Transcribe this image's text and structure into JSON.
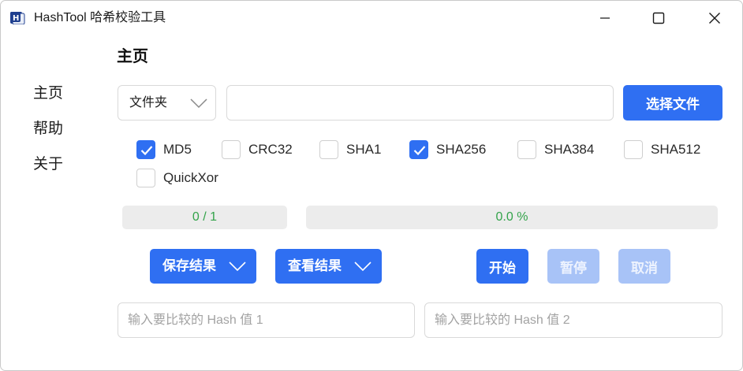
{
  "window": {
    "title": "HashTool 哈希校验工具",
    "icon": "hashtool-app-icon",
    "controls": [
      "minimize-icon",
      "maximize-icon",
      "close-icon"
    ]
  },
  "sidebar": {
    "items": [
      {
        "label": "主页"
      },
      {
        "label": "帮助"
      },
      {
        "label": "关于"
      }
    ]
  },
  "main": {
    "title": "主页",
    "source_select": {
      "value": "文件夹"
    },
    "path_input": {
      "value": "",
      "placeholder": ""
    },
    "choose_button": "选择文件",
    "algorithms": [
      {
        "label": "MD5",
        "checked": true
      },
      {
        "label": "CRC32",
        "checked": false
      },
      {
        "label": "SHA1",
        "checked": false
      },
      {
        "label": "SHA256",
        "checked": true
      },
      {
        "label": "SHA384",
        "checked": false
      },
      {
        "label": "SHA512",
        "checked": false
      },
      {
        "label": "QuickXor",
        "checked": false
      }
    ],
    "file_progress": {
      "text": "0 / 1",
      "fraction": 0
    },
    "percent_progress": {
      "text": "0.0 %",
      "fraction": 0
    },
    "buttons": {
      "save_results": "保存结果",
      "view_results": "查看结果",
      "start": "开始",
      "pause": "暂停",
      "cancel": "取消"
    },
    "compare": {
      "hash1_placeholder": "输入要比较的 Hash 值 1",
      "hash2_placeholder": "输入要比较的 Hash 值 2"
    }
  },
  "colors": {
    "accent": "#2f6ff2",
    "accent_disabled": "#a8c3f7",
    "progress_text": "#33a34a",
    "progress_track": "#ececec"
  }
}
